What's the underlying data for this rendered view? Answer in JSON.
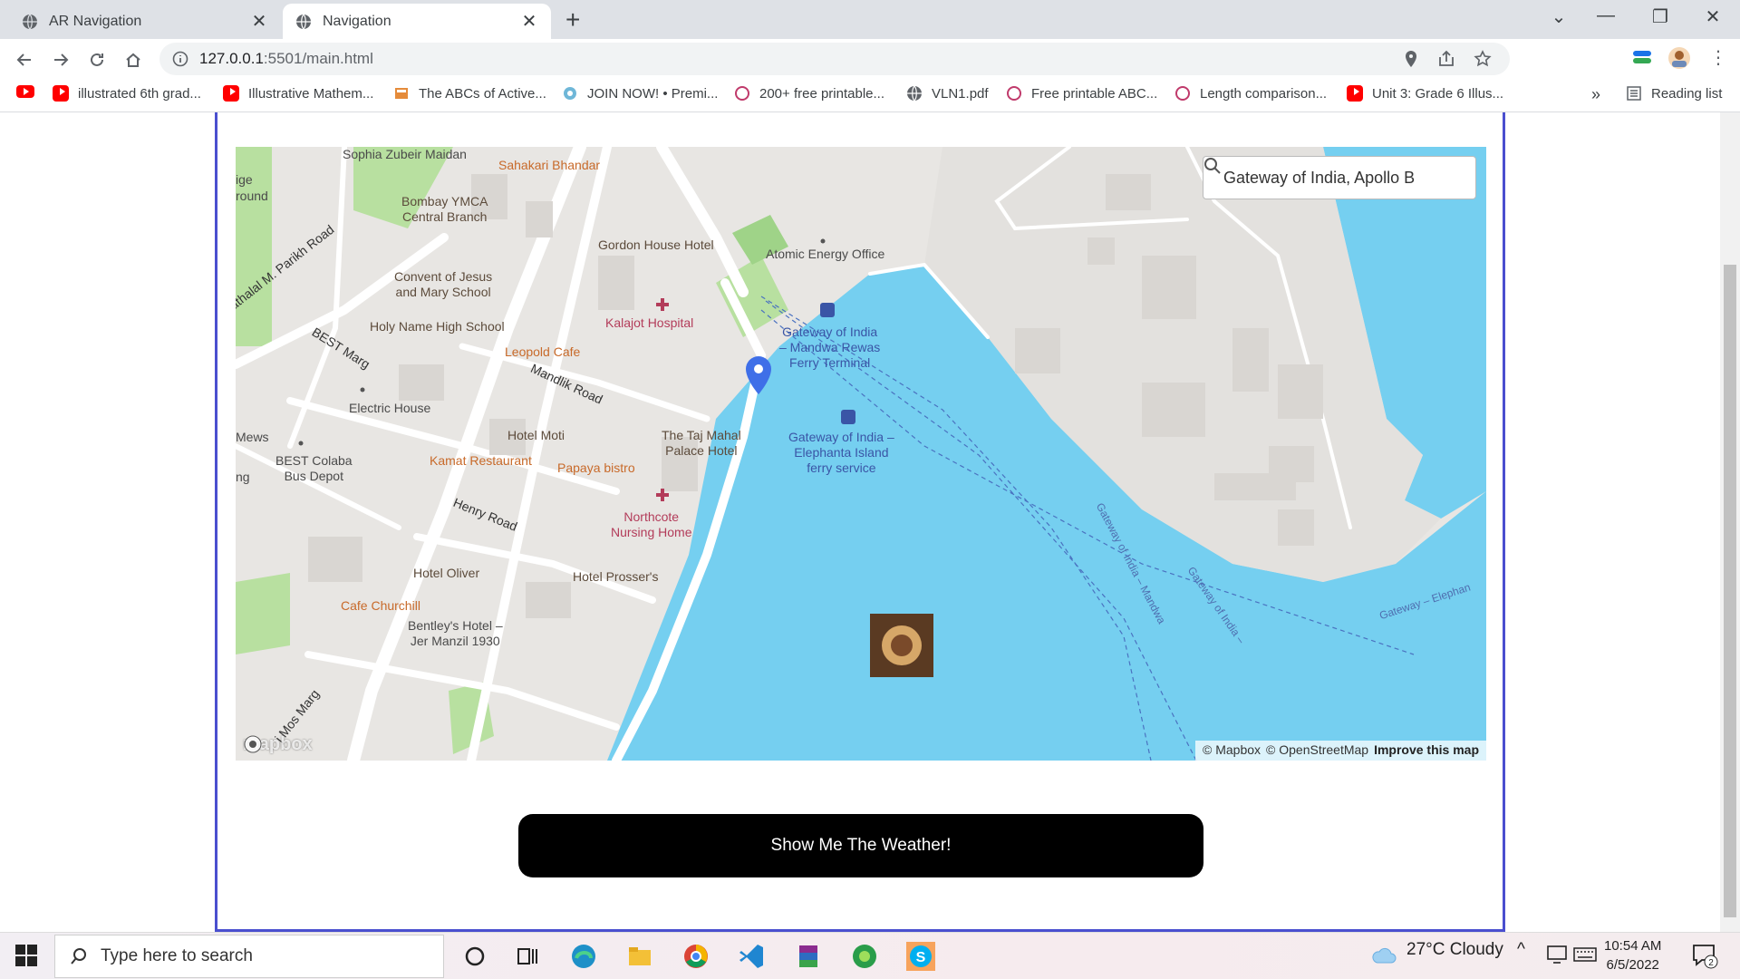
{
  "browser": {
    "tabs": [
      {
        "label": "AR Navigation",
        "active": false
      },
      {
        "label": "Navigation",
        "active": true
      }
    ],
    "url_host": "127.0.0.1",
    "url_path": ":5501/main.html",
    "bookmarks": [
      {
        "label": "illustrated 6th grad...",
        "icon": "youtube-icon"
      },
      {
        "label": "Illustrative Mathem...",
        "icon": "youtube-icon"
      },
      {
        "label": "The ABCs of Active...",
        "icon": "site-icon"
      },
      {
        "label": "JOIN NOW! • Premi...",
        "icon": "site-icon"
      },
      {
        "label": "200+ free printable...",
        "icon": "site-icon"
      },
      {
        "label": "VLN1.pdf",
        "icon": "globe-icon"
      },
      {
        "label": "Free printable ABC...",
        "icon": "site-icon"
      },
      {
        "label": "Length comparison...",
        "icon": "site-icon"
      },
      {
        "label": "Unit 3: Grade 6 Illus...",
        "icon": "youtube-icon"
      }
    ],
    "reading_list": "Reading list"
  },
  "map": {
    "search_value": "Gateway of India, Apollo B",
    "attribution": {
      "mapbox": "© Mapbox",
      "osm": "© OpenStreetMap",
      "improve": "Improve this map"
    },
    "logo": "mapbox",
    "labels": {
      "sophia": "Sophia Zubeir Maidan",
      "sahakari": "Sahakari Bhandar",
      "ymca": "Bombay YMCA\nCentral Branch",
      "gordon": "Gordon House Hotel",
      "atomic": "Atomic Energy Office",
      "convent": "Convent of Jesus\nand Mary School",
      "kalajot": "Kalajot Hospital",
      "holyname": "Holy Name High School",
      "leopold": "Leopold Cafe",
      "ferry_mandwa": "Gateway of India\n– Mandwa Rewas\nFerry Terminal",
      "electric": "Electric House",
      "hotelmoti": "Hotel Moti",
      "tajmahal": "The Taj Mahal\nPalace Hotel",
      "ferry_elephanta": "Gateway of India –\nElephanta Island\nferry service",
      "best": "BEST Colaba\nBus Depot",
      "kamat": "Kamat Restaurant",
      "papaya": "Papaya bistro",
      "northcote": "Northcote\nNursing Home",
      "oliver": "Hotel Oliver",
      "prosser": "Hotel Prosser's",
      "churchill": "Cafe Churchill",
      "bentley": "Bentley's Hotel –\nJer Manzil 1930",
      "mews": "Mews",
      "ige": "ige",
      "round": "round",
      "ng": "ng",
      "parikh": "athalal M. Parikh Road",
      "bestmarg": "BEST Marg",
      "mandlik": "Mandlik Road",
      "henry": "Henry Road",
      "mosmarg": "j Mos Marg",
      "route1": "Gateway of India – Mandwa",
      "route2": "Gateway of India –",
      "route3": "Gateway – Elephan"
    }
  },
  "button": {
    "label": "Show Me The Weather!"
  },
  "taskbar": {
    "search_placeholder": "Type here to search",
    "weather": "27°C  Cloudy",
    "time": "10:54 AM",
    "date": "6/5/2022",
    "notifications": "2"
  },
  "colors": {
    "water": "#75cff0",
    "park": "#b8e0a0",
    "road": "#ffffff",
    "land": "#e8e6e3",
    "button": "#000000",
    "frame_border": "#4a4fcf",
    "marker": "#3f6fe8"
  }
}
